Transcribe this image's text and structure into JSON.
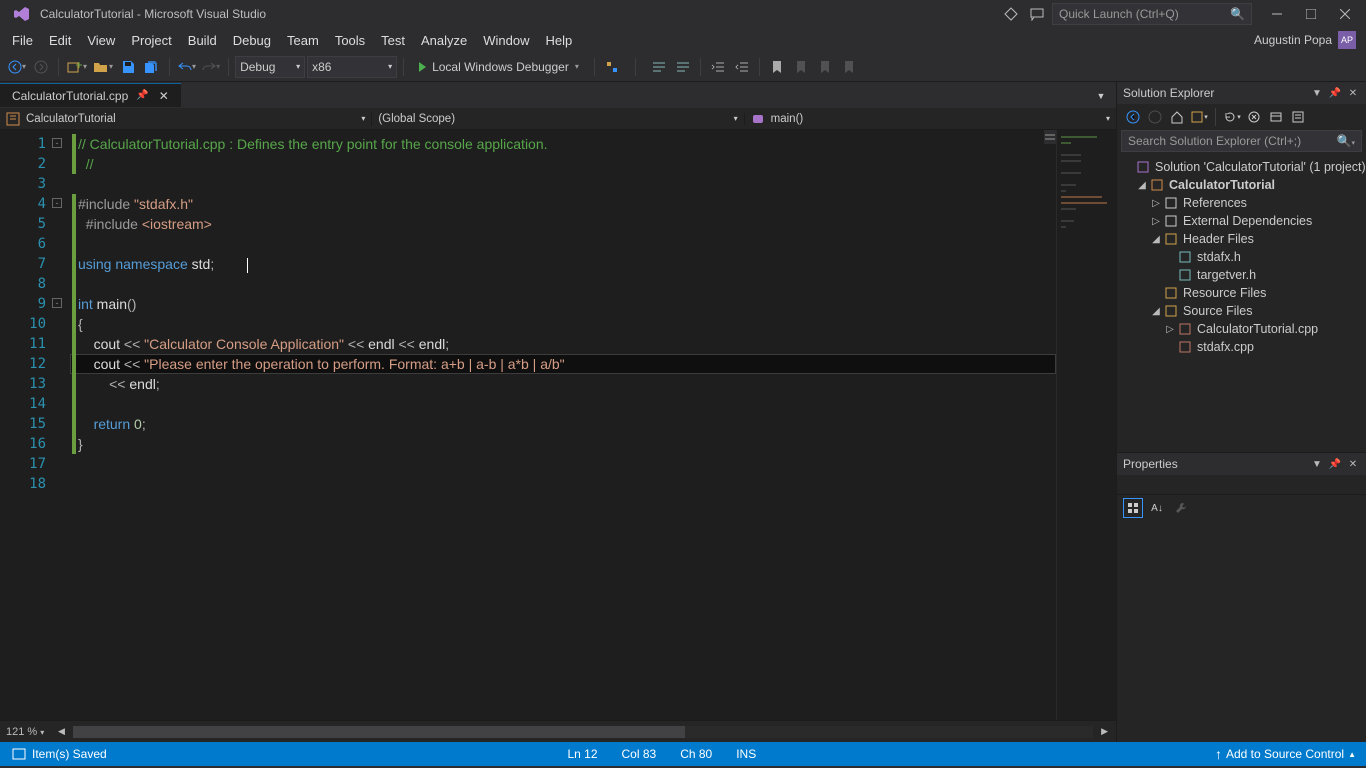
{
  "title": "CalculatorTutorial - Microsoft Visual Studio",
  "quick_launch_placeholder": "Quick Launch (Ctrl+Q)",
  "user": "Augustin Popa",
  "user_initials": "AP",
  "menu": [
    "File",
    "Edit",
    "View",
    "Project",
    "Build",
    "Debug",
    "Team",
    "Tools",
    "Test",
    "Analyze",
    "Window",
    "Help"
  ],
  "config_selected": "Debug",
  "platform_selected": "x86",
  "start_label": "Local Windows Debugger",
  "tab_name": "CalculatorTutorial.cpp",
  "nav_left": "CalculatorTutorial",
  "nav_mid": "(Global Scope)",
  "nav_right": "main()",
  "zoom": "121 %",
  "code": {
    "lines": [
      {
        "n": 1,
        "bar": "green",
        "fold": "-",
        "tokens": [
          [
            "comment",
            "// CalculatorTutorial.cpp : Defines the entry point for the console application."
          ]
        ]
      },
      {
        "n": 2,
        "bar": "green",
        "indent": "  ",
        "tokens": [
          [
            "comment",
            "//"
          ]
        ]
      },
      {
        "n": 3,
        "bar": "",
        "tokens": []
      },
      {
        "n": 4,
        "bar": "green",
        "fold": "-",
        "tokens": [
          [
            "pre",
            "#include "
          ],
          [
            "string",
            "\"stdafx.h\""
          ]
        ]
      },
      {
        "n": 5,
        "bar": "green",
        "indent": "  ",
        "tokens": [
          [
            "pre",
            "#include "
          ],
          [
            "string",
            "<iostream>"
          ]
        ]
      },
      {
        "n": 6,
        "bar": "green",
        "tokens": []
      },
      {
        "n": 7,
        "bar": "green",
        "tokens": [
          [
            "keyword",
            "using"
          ],
          [
            "plain",
            " "
          ],
          [
            "keyword",
            "namespace"
          ],
          [
            "plain",
            " std"
          ],
          [
            "op",
            ";"
          ]
        ]
      },
      {
        "n": 8,
        "bar": "green",
        "tokens": []
      },
      {
        "n": 9,
        "bar": "green",
        "fold": "-",
        "tokens": [
          [
            "keyword",
            "int"
          ],
          [
            "plain",
            " main"
          ],
          [
            "op",
            "()"
          ]
        ]
      },
      {
        "n": 10,
        "bar": "green",
        "tokens": [
          [
            "op",
            "{"
          ]
        ]
      },
      {
        "n": 11,
        "bar": "green",
        "indent": "    ",
        "tokens": [
          [
            "plain",
            "cout "
          ],
          [
            "op",
            "<<"
          ],
          [
            "plain",
            " "
          ],
          [
            "string",
            "\"Calculator Console Application\""
          ],
          [
            "plain",
            " "
          ],
          [
            "op",
            "<<"
          ],
          [
            "plain",
            " endl "
          ],
          [
            "op",
            "<<"
          ],
          [
            "plain",
            " endl"
          ],
          [
            "op",
            ";"
          ]
        ]
      },
      {
        "n": 12,
        "bar": "green",
        "hl": true,
        "indent": "    ",
        "tokens": [
          [
            "plain",
            "cout "
          ],
          [
            "op",
            "<<"
          ],
          [
            "plain",
            " "
          ],
          [
            "string",
            "\"Please enter the operation to perform. Format: a+b | a-b | a*b | a/b\""
          ]
        ]
      },
      {
        "n": 13,
        "bar": "green",
        "indent": "        ",
        "tokens": [
          [
            "op",
            "<<"
          ],
          [
            "plain",
            " endl"
          ],
          [
            "op",
            ";"
          ]
        ]
      },
      {
        "n": 14,
        "bar": "green",
        "tokens": []
      },
      {
        "n": 15,
        "bar": "green",
        "indent": "    ",
        "tokens": [
          [
            "keyword",
            "return"
          ],
          [
            "plain",
            " "
          ],
          [
            "num",
            "0"
          ],
          [
            "op",
            ";"
          ]
        ]
      },
      {
        "n": 16,
        "bar": "green",
        "tokens": [
          [
            "op",
            "}"
          ]
        ]
      },
      {
        "n": 17,
        "bar": "",
        "tokens": []
      },
      {
        "n": 18,
        "bar": "",
        "tokens": []
      }
    ]
  },
  "solution_explorer": {
    "title": "Solution Explorer",
    "search_placeholder": "Search Solution Explorer (Ctrl+;)",
    "root": "Solution 'CalculatorTutorial' (1 project)",
    "project": "CalculatorTutorial",
    "nodes": [
      {
        "d": 2,
        "tw": "▷",
        "ic": "ref",
        "lbl": "References"
      },
      {
        "d": 2,
        "tw": "▷",
        "ic": "ext",
        "lbl": "External Dependencies"
      },
      {
        "d": 2,
        "tw": "◢",
        "ic": "folder",
        "lbl": "Header Files"
      },
      {
        "d": 3,
        "tw": "",
        "ic": "h",
        "lbl": "stdafx.h"
      },
      {
        "d": 3,
        "tw": "",
        "ic": "h",
        "lbl": "targetver.h"
      },
      {
        "d": 2,
        "tw": "",
        "ic": "folder",
        "lbl": "Resource Files"
      },
      {
        "d": 2,
        "tw": "◢",
        "ic": "folder",
        "lbl": "Source Files"
      },
      {
        "d": 3,
        "tw": "▷",
        "ic": "cpp",
        "lbl": "CalculatorTutorial.cpp"
      },
      {
        "d": 3,
        "tw": "",
        "ic": "cpp",
        "lbl": "stdafx.cpp"
      }
    ]
  },
  "properties_title": "Properties",
  "status": {
    "save": "Item(s) Saved",
    "ln": "Ln 12",
    "col": "Col 83",
    "ch": "Ch 80",
    "ins": "INS",
    "scm": "Add to Source Control"
  }
}
